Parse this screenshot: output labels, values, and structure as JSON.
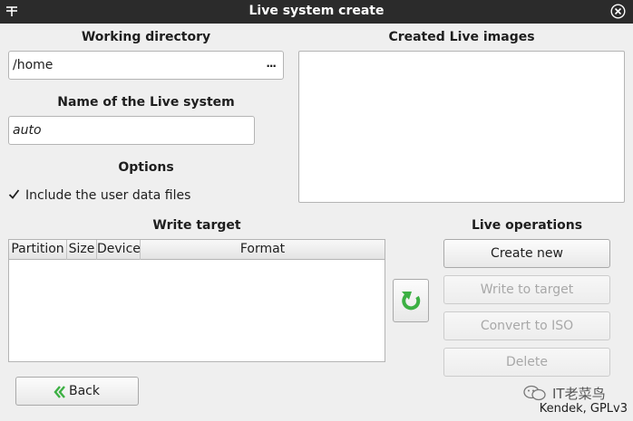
{
  "window": {
    "title": "Live system create"
  },
  "working_directory": {
    "heading": "Working directory",
    "value": "/home",
    "browse_label": "..."
  },
  "live_name": {
    "heading": "Name of the Live system",
    "value": "auto"
  },
  "options": {
    "heading": "Options",
    "include_user_data": {
      "label": "Include the user data files",
      "checked": true
    }
  },
  "created_images": {
    "heading": "Created Live images"
  },
  "write_target": {
    "heading": "Write target",
    "columns": [
      "Partition",
      "Size",
      "Device",
      "Format"
    ]
  },
  "live_operations": {
    "heading": "Live operations",
    "create_new": "Create new",
    "write_to_target": "Write to target",
    "convert_to_iso": "Convert to ISO",
    "delete": "Delete"
  },
  "back_label": "Back",
  "watermark": "IT老菜鸟",
  "footer": "Kendek, GPLv3",
  "colors": {
    "titlebar": "#2b2b2b",
    "accent_green": "#3cb043",
    "disabled_text": "#a8a8a8"
  }
}
